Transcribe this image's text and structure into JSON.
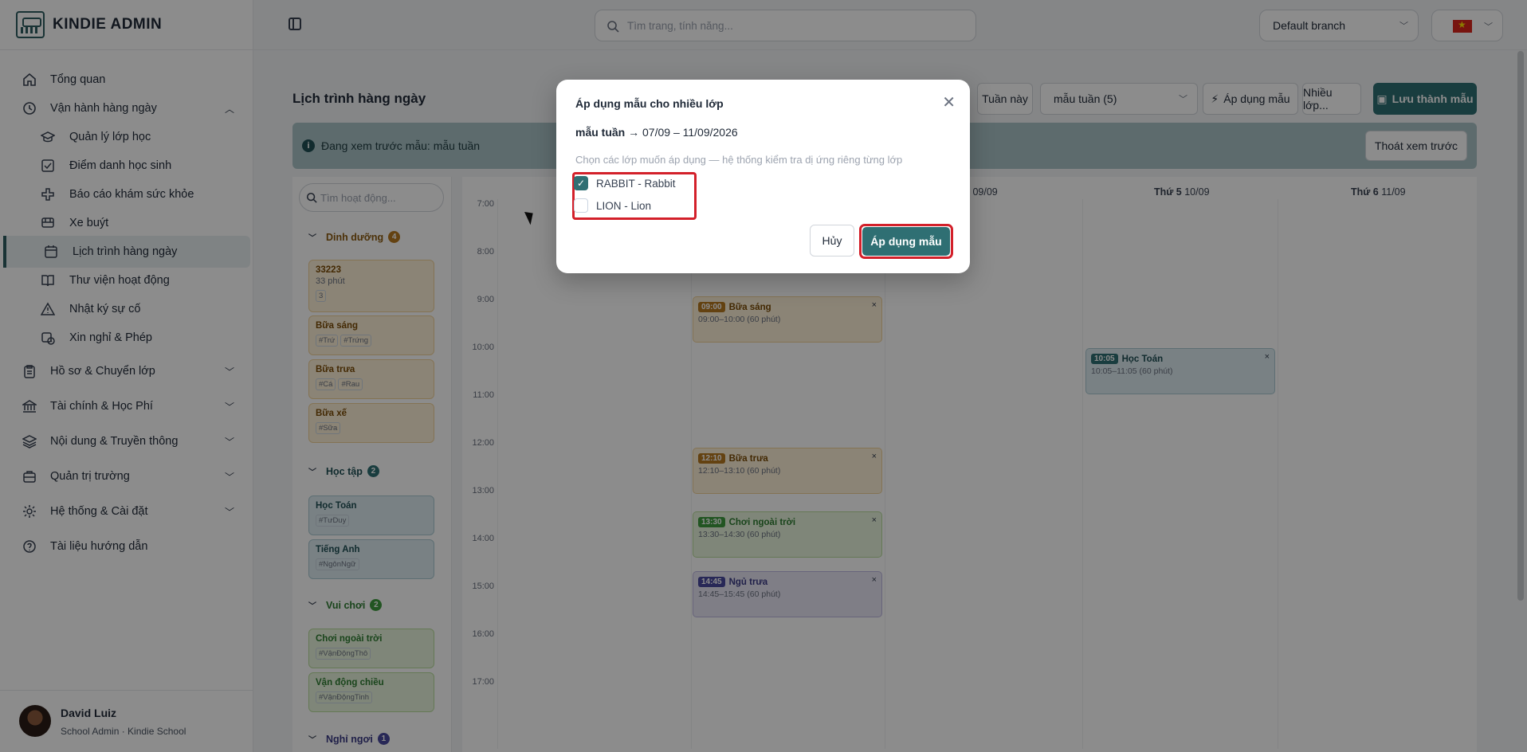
{
  "app": {
    "title": "KINDIE ADMIN"
  },
  "topbar": {
    "search_placeholder": "Tìm trang, tính năng...",
    "branch": "Default branch"
  },
  "sidebar": {
    "items": [
      {
        "label": "Tổng quan",
        "icon": "home-icon"
      },
      {
        "label": "Vận hành hàng ngày",
        "icon": "clock-icon",
        "expanded": true
      },
      {
        "label": "Quản lý lớp học",
        "icon": "graduation-cap-icon"
      },
      {
        "label": "Điểm danh học sinh",
        "icon": "checkbox-icon"
      },
      {
        "label": "Báo cáo khám sức khỏe",
        "icon": "medical-cross-icon"
      },
      {
        "label": "Xe buýt",
        "icon": "bus-icon"
      },
      {
        "label": "Lịch trình hàng ngày",
        "icon": "calendar-icon",
        "active": true
      },
      {
        "label": "Thư viện hoạt động",
        "icon": "book-icon"
      },
      {
        "label": "Nhật ký sự cố",
        "icon": "warning-icon"
      },
      {
        "label": "Xin nghỉ & Phép",
        "icon": "calendar-clock-icon"
      },
      {
        "label": "Hồ sơ & Chuyển lớp",
        "icon": "clipboard-icon"
      },
      {
        "label": "Tài chính & Học Phí",
        "icon": "bank-icon"
      },
      {
        "label": "Nội dung & Truyền thông",
        "icon": "layers-icon"
      },
      {
        "label": "Quản trị trường",
        "icon": "briefcase-icon"
      },
      {
        "label": "Hệ thống & Cài đặt",
        "icon": "gear-icon"
      },
      {
        "label": "Tài liệu hướng dẫn",
        "icon": "help-circle-icon"
      }
    ]
  },
  "user": {
    "name": "David Luiz",
    "role": "School Admin · Kindie School"
  },
  "page": {
    "title": "Lịch trình hàng ngày"
  },
  "toolbar": {
    "this_week": "Tuần này",
    "template_select": "mẫu tuần (5)",
    "apply_template": "Áp dụng mẫu",
    "multi_class": "Nhiều lớp...",
    "save_template": "Lưu thành mẫu"
  },
  "banner": {
    "text": "Đang xem trước mẫu: mẫu tuần",
    "exit_label": "Thoát xem trước"
  },
  "palette": {
    "search_placeholder": "Tìm hoạt động...",
    "categories": [
      {
        "name": "Dinh dưỡng",
        "count": "4",
        "color": "#b7791f",
        "cards": [
          {
            "title": "33223",
            "sub": "33 phút",
            "tags": [
              "3"
            ]
          },
          {
            "title": "Bữa sáng",
            "tags": [
              "#Trứ",
              "#Trứng"
            ]
          },
          {
            "title": "Bữa trưa",
            "tags": [
              "#Cá",
              "#Rau"
            ]
          },
          {
            "title": "Bữa xế",
            "tags": [
              "#Sữa"
            ]
          }
        ]
      },
      {
        "name": "Học tập",
        "count": "2",
        "color": "#2f6f73",
        "cards": [
          {
            "title": "Học Toán",
            "tags": [
              "#TưDuy"
            ]
          },
          {
            "title": "Tiếng Anh",
            "tags": [
              "#NgônNgữ"
            ]
          }
        ]
      },
      {
        "name": "Vui chơi",
        "count": "2",
        "color": "#3f9b3f",
        "cards": [
          {
            "title": "Chơi ngoài trời",
            "tags": [
              "#VậnĐộngThô"
            ]
          },
          {
            "title": "Vận động chiều",
            "tags": [
              "#VậnĐộngTinh"
            ]
          }
        ]
      },
      {
        "name": "Nghỉ ngơi",
        "count": "1",
        "color": "#4a4a9e",
        "cards": []
      }
    ]
  },
  "calendar": {
    "days": [
      {
        "name": "Thứ 4",
        "date": "09/09",
        "show_name": "4"
      },
      {
        "name": "Thứ 5",
        "date": "10/09"
      },
      {
        "name": "Thứ 6",
        "date": "11/09"
      }
    ],
    "hours": [
      "7:00",
      "8:00",
      "9:00",
      "10:00",
      "11:00",
      "12:00",
      "13:00",
      "14:00",
      "15:00",
      "16:00",
      "17:00"
    ],
    "events": [
      {
        "time": "09:00",
        "title": "Bữa sáng",
        "range": "09:00–10:00 (60 phút)",
        "color": "#b7791f"
      },
      {
        "time": "12:10",
        "title": "Bữa trưa",
        "range": "12:10–13:10 (60 phút)",
        "color": "#b7791f"
      },
      {
        "time": "13:30",
        "title": "Chơi ngoài trời",
        "range": "13:30–14:30 (60 phút)",
        "color": "#3f9b3f"
      },
      {
        "time": "14:45",
        "title": "Ngủ trưa",
        "range": "14:45–15:45 (60 phút)",
        "color": "#4a4a9e"
      },
      {
        "time": "10:05",
        "title": "Học Toán",
        "range": "10:05–11:05 (60 phút)",
        "color": "#2f6f73"
      }
    ]
  },
  "modal": {
    "title": "Áp dụng mẫu cho nhiều lớp",
    "template_name": "mẫu tuần",
    "date_range": "→ 07/09 – 11/09/2026",
    "hint": "Chọn các lớp muốn áp dụng — hệ thống kiểm tra dị ứng riêng từng lớp",
    "options": [
      {
        "label": "RABBIT - Rabbit",
        "checked": true
      },
      {
        "label": "LION - Lion",
        "checked": false
      }
    ],
    "cancel_label": "Hủy",
    "apply_label": "Áp dụng mẫu"
  },
  "colors": {
    "primary": "#2f6f73",
    "highlight": "#d3202a"
  }
}
